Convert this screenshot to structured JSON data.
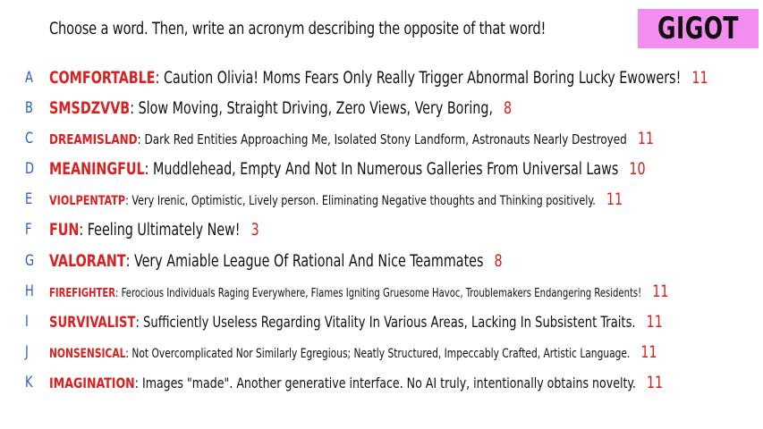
{
  "prompt": "Choose a word. Then, write an acronym describing the opposite of that word!",
  "badge": "GIGOT",
  "colors": {
    "word": "#dc1f1f",
    "letter": "#2a5fd6",
    "badge_bg": "#f38ef0"
  },
  "entries": [
    {
      "letter": "A",
      "word": "COMFORTABLE",
      "acronym": "Caution Olivia! Moms Fears  Only Really Trigger Abnormal Boring Lucky Ewowers!",
      "score": "11"
    },
    {
      "letter": "B",
      "word": "SMSDZVVB",
      "acronym": "Slow Moving, Straight Driving, Zero Views, Very Boring,",
      "score": "8"
    },
    {
      "letter": "C",
      "word": "DREAMISLAND",
      "acronym": "Dark Red Entities Approaching Me, Isolated Stony Landform, Astronauts Nearly Destroyed",
      "score": "11"
    },
    {
      "letter": "D",
      "word": "MEANINGFUL",
      "acronym": "Muddlehead, Empty And Not In Numerous Galleries From Universal Laws",
      "score": "10"
    },
    {
      "letter": "E",
      "word": "VIOLPENTATP",
      "acronym": "Very Irenic, Optimistic, Lively person. Eliminating Negative thoughts and Thinking positively.",
      "score": "11"
    },
    {
      "letter": "F",
      "word": "FUN",
      "acronym": "Feeling Ultimately New!",
      "score": "3"
    },
    {
      "letter": "G",
      "word": "VALORANT",
      "acronym": "Very Amiable League Of Rational And Nice Teammates",
      "score": "8"
    },
    {
      "letter": "H",
      "word": "FIREFIGHTER",
      "acronym": "Ferocious Individuals Raging Everywhere, Flames Igniting Gruesome Havoc, Troublemakers Endangering Residents!",
      "score": "11"
    },
    {
      "letter": "I",
      "word": "SURVIVALIST",
      "acronym": "Sufficiently Useless Regarding Vitality In Various Areas, Lacking In Subsistent Traits.",
      "score": "11"
    },
    {
      "letter": "J",
      "word": "NONSENSICAL",
      "acronym": "Not Overcomplicated Nor Similarly Egregious; Neatly Structured, Impeccably Crafted, Artistic Language.",
      "score": "11"
    },
    {
      "letter": "K",
      "word": "IMAGINATION",
      "acronym": "Images \"made\". Another generative interface. No AI truly, intentionally obtains novelty.",
      "score": "11"
    }
  ]
}
